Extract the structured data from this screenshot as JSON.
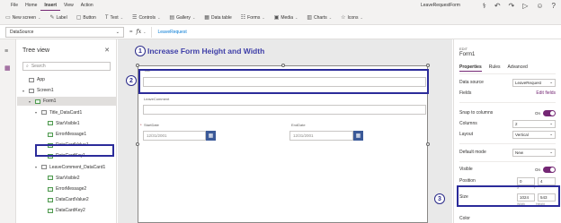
{
  "menu": [
    "File",
    "Home",
    "Insert",
    "View",
    "Action"
  ],
  "app_title": "LeaveRequestForm",
  "ribbon": [
    {
      "label": "New screen",
      "icon": "new-screen-icon",
      "chev": true
    },
    {
      "label": "Label",
      "icon": "label-icon",
      "chev": false
    },
    {
      "label": "Button",
      "icon": "button-icon",
      "chev": false
    },
    {
      "label": "Text",
      "icon": "text-icon",
      "chev": true
    },
    {
      "label": "Controls",
      "icon": "controls-icon",
      "chev": true
    },
    {
      "label": "Gallery",
      "icon": "gallery-icon",
      "chev": true
    },
    {
      "label": "Data table",
      "icon": "data-table-icon",
      "chev": false
    },
    {
      "label": "Forms",
      "icon": "forms-icon",
      "chev": true
    },
    {
      "label": "Media",
      "icon": "media-icon",
      "chev": true
    },
    {
      "label": "Charts",
      "icon": "charts-icon",
      "chev": true
    },
    {
      "label": "Icons",
      "icon": "icons-icon",
      "chev": true
    }
  ],
  "formula": {
    "property": "DataSource",
    "equals": "=",
    "fx": "fx",
    "value": "LeaveRequest"
  },
  "tree": {
    "title": "Tree view",
    "search_placeholder": "Search",
    "items": [
      {
        "label": "App",
        "indent": 0,
        "twisty": "",
        "icon": "page"
      },
      {
        "label": "Screen1",
        "indent": 0,
        "twisty": "▾",
        "icon": "page"
      },
      {
        "label": "Form1",
        "indent": 1,
        "twisty": "▾",
        "icon": "green",
        "selected": true
      },
      {
        "label": "Title_DataCard1",
        "indent": 2,
        "twisty": "▾",
        "icon": "page"
      },
      {
        "label": "StarVisible1",
        "indent": 3,
        "twisty": "",
        "icon": "green"
      },
      {
        "label": "ErrorMessage1",
        "indent": 3,
        "twisty": "",
        "icon": "green"
      },
      {
        "label": "DataCardValue1",
        "indent": 3,
        "twisty": "",
        "icon": "green"
      },
      {
        "label": "DataCardKey1",
        "indent": 3,
        "twisty": "",
        "icon": "green"
      },
      {
        "label": "LeaveComment_DataCard1",
        "indent": 2,
        "twisty": "▾",
        "icon": "page"
      },
      {
        "label": "StarVisible2",
        "indent": 3,
        "twisty": "",
        "icon": "green"
      },
      {
        "label": "ErrorMessage2",
        "indent": 3,
        "twisty": "",
        "icon": "green"
      },
      {
        "label": "DataCardValue2",
        "indent": 3,
        "twisty": "",
        "icon": "green"
      },
      {
        "label": "DataCardKey2",
        "indent": 3,
        "twisty": "",
        "icon": "green"
      }
    ]
  },
  "canvas": {
    "annotation_1": "1",
    "annotation_1_text": "Increase Form Height and Width",
    "annotation_2": "2",
    "annotation_3": "3",
    "title_label": "Title",
    "title_star": "*",
    "comment_label": "LeaveComment",
    "startdate_label": "StartDate",
    "startdate_star": "*",
    "enddate_label": "EndDate",
    "start_value": "12/31/2001",
    "end_value": "12/31/2001"
  },
  "props": {
    "edit": "EDIT",
    "name": "Form1",
    "tabs": [
      "Properties",
      "Rules",
      "Advanced"
    ],
    "data_source_label": "Data source",
    "data_source_value": "LeaveRequest",
    "fields_label": "Fields",
    "fields_link": "Edit fields",
    "snap_label": "Snap to columns",
    "snap_value": "On",
    "columns_label": "Columns",
    "columns_value": "2",
    "layout_label": "Layout",
    "layout_value": "Vertical",
    "default_mode_label": "Default mode",
    "default_mode_value": "New",
    "visible_label": "Visible",
    "visible_value": "On",
    "position_label": "Position",
    "pos_x": "0",
    "pos_y": "4",
    "pos_x_lbl": "X",
    "pos_y_lbl": "Y",
    "size_label": "Size",
    "width": "1024",
    "height": "543",
    "width_lbl": "Width",
    "height_lbl": "Height",
    "color_label": "Color"
  }
}
